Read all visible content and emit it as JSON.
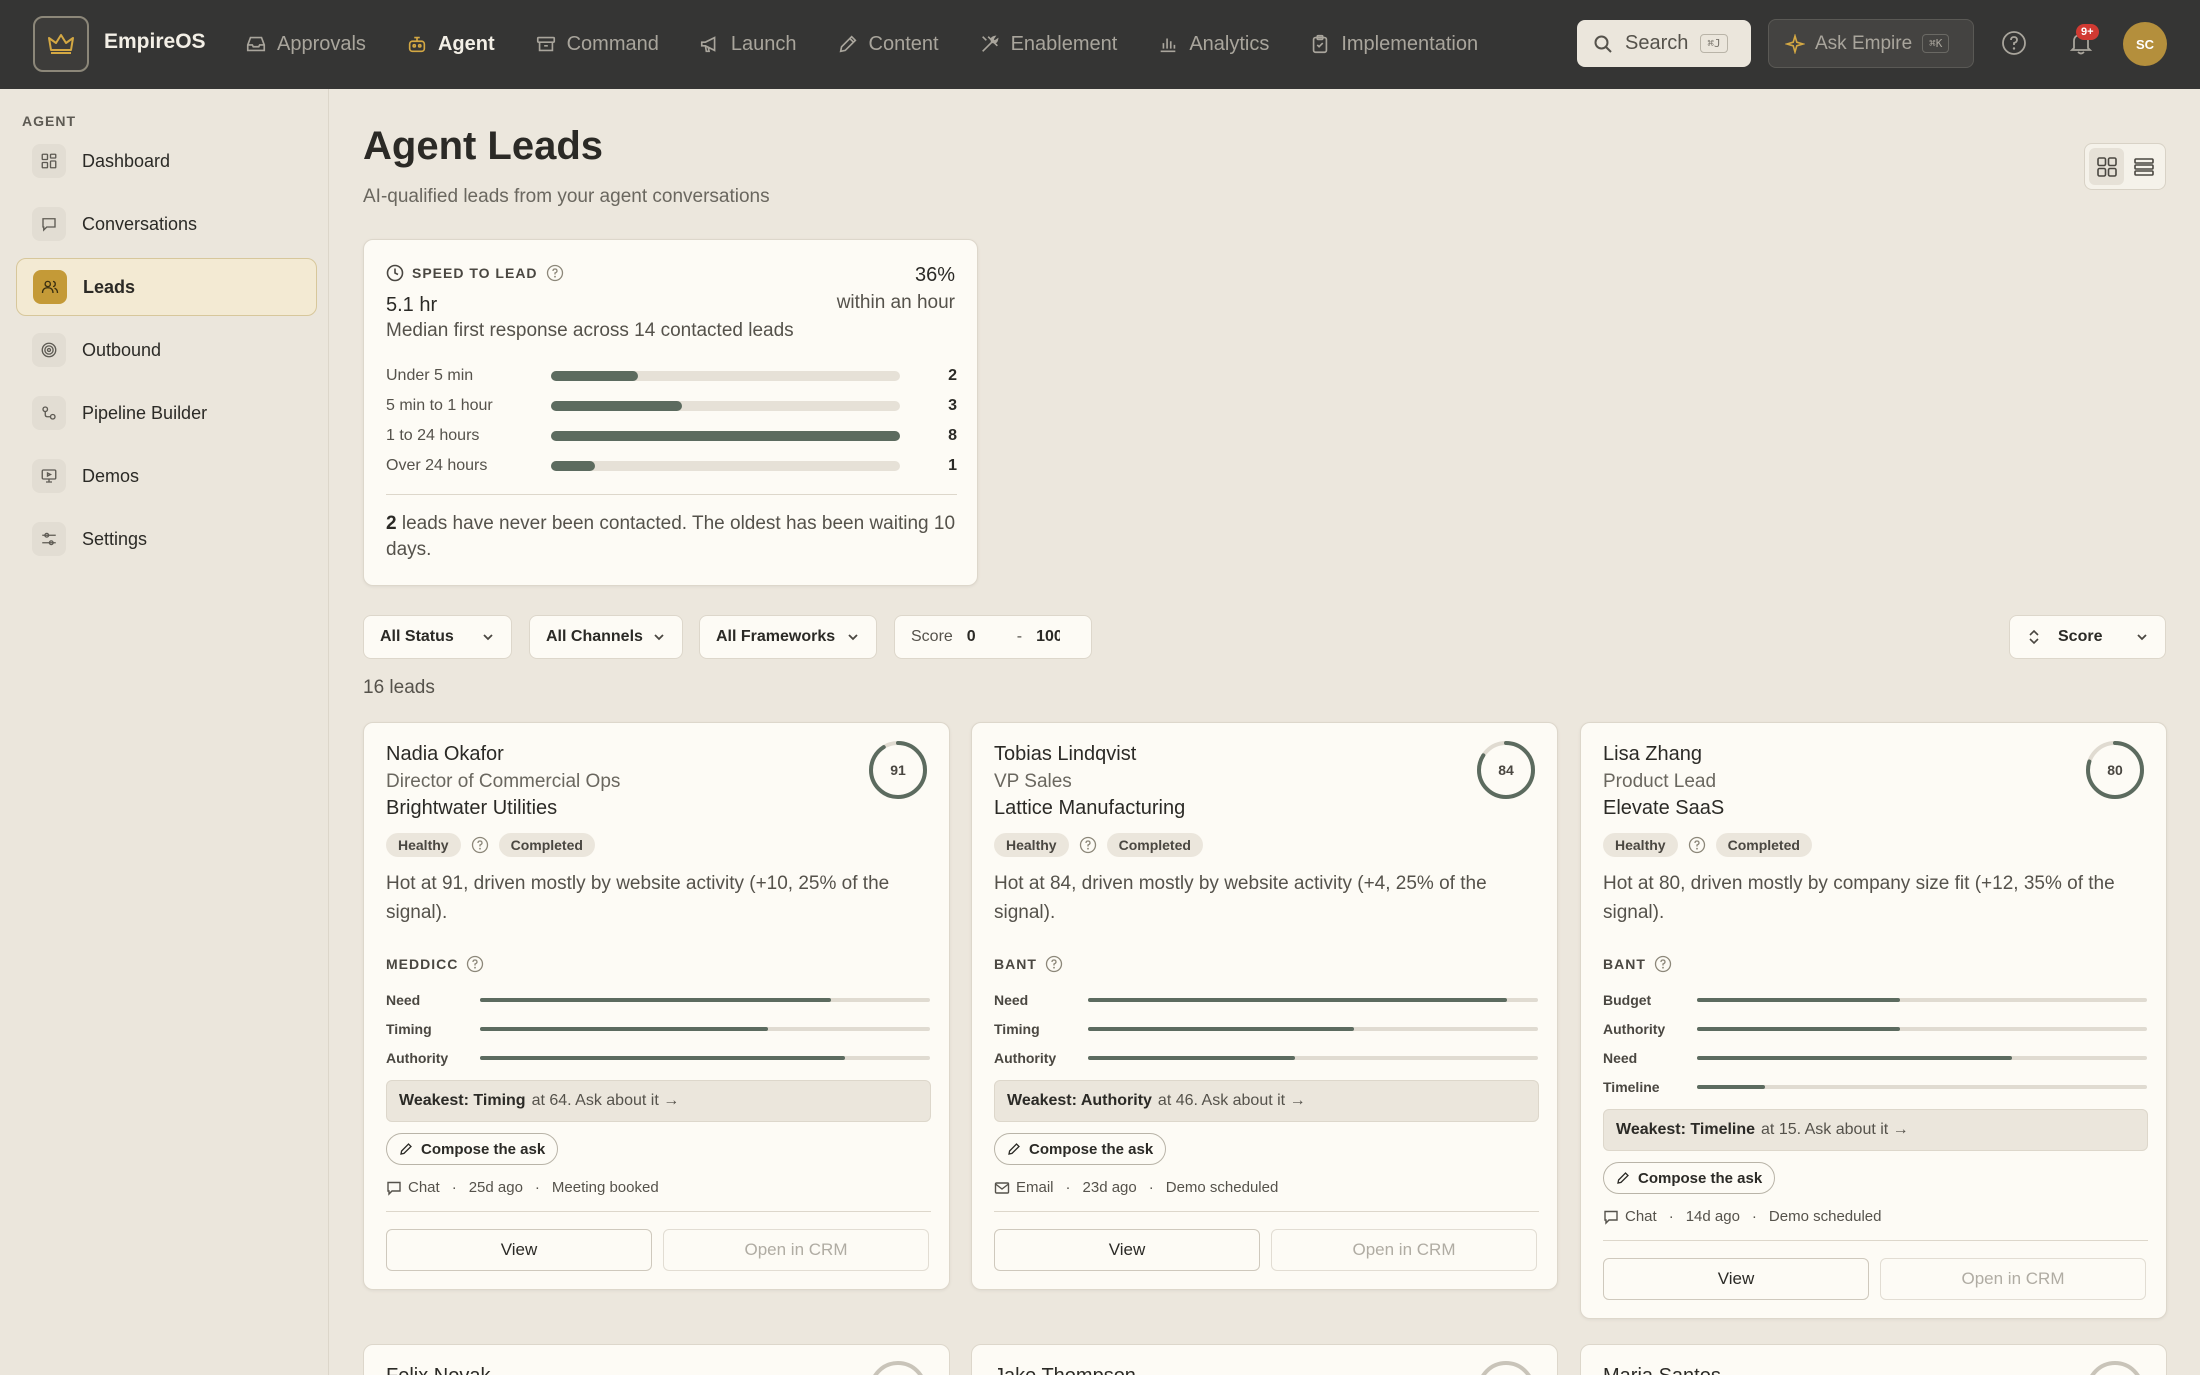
{
  "app": {
    "brand": "EmpireOS",
    "nav": [
      {
        "label": "Approvals",
        "icon": "inbox-icon"
      },
      {
        "label": "Agent",
        "icon": "robot-icon",
        "active": true
      },
      {
        "label": "Command",
        "icon": "archive-icon"
      },
      {
        "label": "Launch",
        "icon": "megaphone-icon"
      },
      {
        "label": "Content",
        "icon": "pencil-icon"
      },
      {
        "label": "Enablement",
        "icon": "tools-icon"
      },
      {
        "label": "Analytics",
        "icon": "bar-chart-icon"
      },
      {
        "label": "Implementation",
        "icon": "clipboard-icon"
      }
    ],
    "search_label": "Search",
    "search_shortcut": "⌘J",
    "ask_label": "Ask Empire",
    "ask_shortcut": "⌘K",
    "notification_count": "9+",
    "avatar_initials": "SC"
  },
  "sidebar": {
    "heading": "AGENT",
    "items": [
      {
        "label": "Dashboard",
        "icon": "grid-icon"
      },
      {
        "label": "Conversations",
        "icon": "chat-icon"
      },
      {
        "label": "Leads",
        "icon": "users-icon",
        "active": true
      },
      {
        "label": "Outbound",
        "icon": "target-icon"
      },
      {
        "label": "Pipeline Builder",
        "icon": "pipeline-icon"
      },
      {
        "label": "Demos",
        "icon": "monitor-icon"
      },
      {
        "label": "Settings",
        "icon": "sliders-icon"
      }
    ]
  },
  "page": {
    "title": "Agent Leads",
    "subtitle": "AI-qualified leads from your agent conversations"
  },
  "speed": {
    "label": "SPEED TO LEAD",
    "value": "5.1 hr",
    "description": "Median first response across 14 contacted leads",
    "pct": "36%",
    "pct_label": "within an hour",
    "rows": [
      {
        "label": "Under 5 min",
        "count": "2",
        "fraction": 0.25
      },
      {
        "label": "5 min to 1 hour",
        "count": "3",
        "fraction": 0.375
      },
      {
        "label": "1 to 24 hours",
        "count": "8",
        "fraction": 1.0
      },
      {
        "label": "Over 24 hours",
        "count": "1",
        "fraction": 0.125
      }
    ],
    "footer_count": "2",
    "footer_text": " leads have never been contacted. The oldest has been waiting 10 days."
  },
  "filters": {
    "status": "All Status",
    "channels": "All Channels",
    "frameworks": "All Frameworks",
    "score_label": "Score",
    "score_min": "0",
    "score_sep": "-",
    "score_max": "100",
    "sort": "Score"
  },
  "lead_count": "16 leads",
  "leads": [
    {
      "name": "Nadia Okafor",
      "title": "Director of Commercial Ops",
      "company": "Brightwater Utilities",
      "score": "91",
      "score_value": 91,
      "health": "Healthy",
      "status": "Completed",
      "summary": "Hot at 91, driven mostly by website activity (+10, 25% of the signal).",
      "framework": "MEDDICC",
      "bars": [
        {
          "label": "Need",
          "value": 78
        },
        {
          "label": "Timing",
          "value": 64
        },
        {
          "label": "Authority",
          "value": 81
        }
      ],
      "weak_label": "Weakest: Timing",
      "weak_rest": "at 64. Ask about it →",
      "compose": "Compose the ask",
      "channel": "Chat",
      "channel_icon": "chat-icon",
      "age": "25d ago",
      "outcome": "Meeting booked",
      "view": "View",
      "crm": "Open in CRM"
    },
    {
      "name": "Tobias Lindqvist",
      "title": "VP Sales",
      "company": "Lattice Manufacturing",
      "score": "84",
      "score_value": 84,
      "health": "Healthy",
      "status": "Completed",
      "summary": "Hot at 84, driven mostly by website activity (+4, 25% of the signal).",
      "framework": "BANT",
      "bars": [
        {
          "label": "Need",
          "value": 93
        },
        {
          "label": "Timing",
          "value": 59
        },
        {
          "label": "Authority",
          "value": 46
        }
      ],
      "weak_label": "Weakest: Authority",
      "weak_rest": "at 46. Ask about it →",
      "compose": "Compose the ask",
      "channel": "Email",
      "channel_icon": "mail-icon",
      "age": "23d ago",
      "outcome": "Demo scheduled",
      "view": "View",
      "crm": "Open in CRM"
    },
    {
      "name": "Lisa Zhang",
      "title": "Product Lead",
      "company": "Elevate SaaS",
      "score": "80",
      "score_value": 80,
      "health": "Healthy",
      "status": "Completed",
      "summary": "Hot at 80, driven mostly by company size fit (+12, 35% of the signal).",
      "framework": "BANT",
      "bars": [
        {
          "label": "Budget",
          "value": 45
        },
        {
          "label": "Authority",
          "value": 45
        },
        {
          "label": "Need",
          "value": 70
        },
        {
          "label": "Timeline",
          "value": 15
        }
      ],
      "weak_label": "Weakest: Timeline",
      "weak_rest": "at 15. Ask about it →",
      "compose": "Compose the ask",
      "channel": "Chat",
      "channel_icon": "chat-icon",
      "age": "14d ago",
      "outcome": "Demo scheduled",
      "view": "View",
      "crm": "Open in CRM"
    }
  ],
  "next_leads": [
    {
      "name": "Felix Novak"
    },
    {
      "name": "Jake Thompson"
    },
    {
      "name": "Maria Santos"
    }
  ]
}
